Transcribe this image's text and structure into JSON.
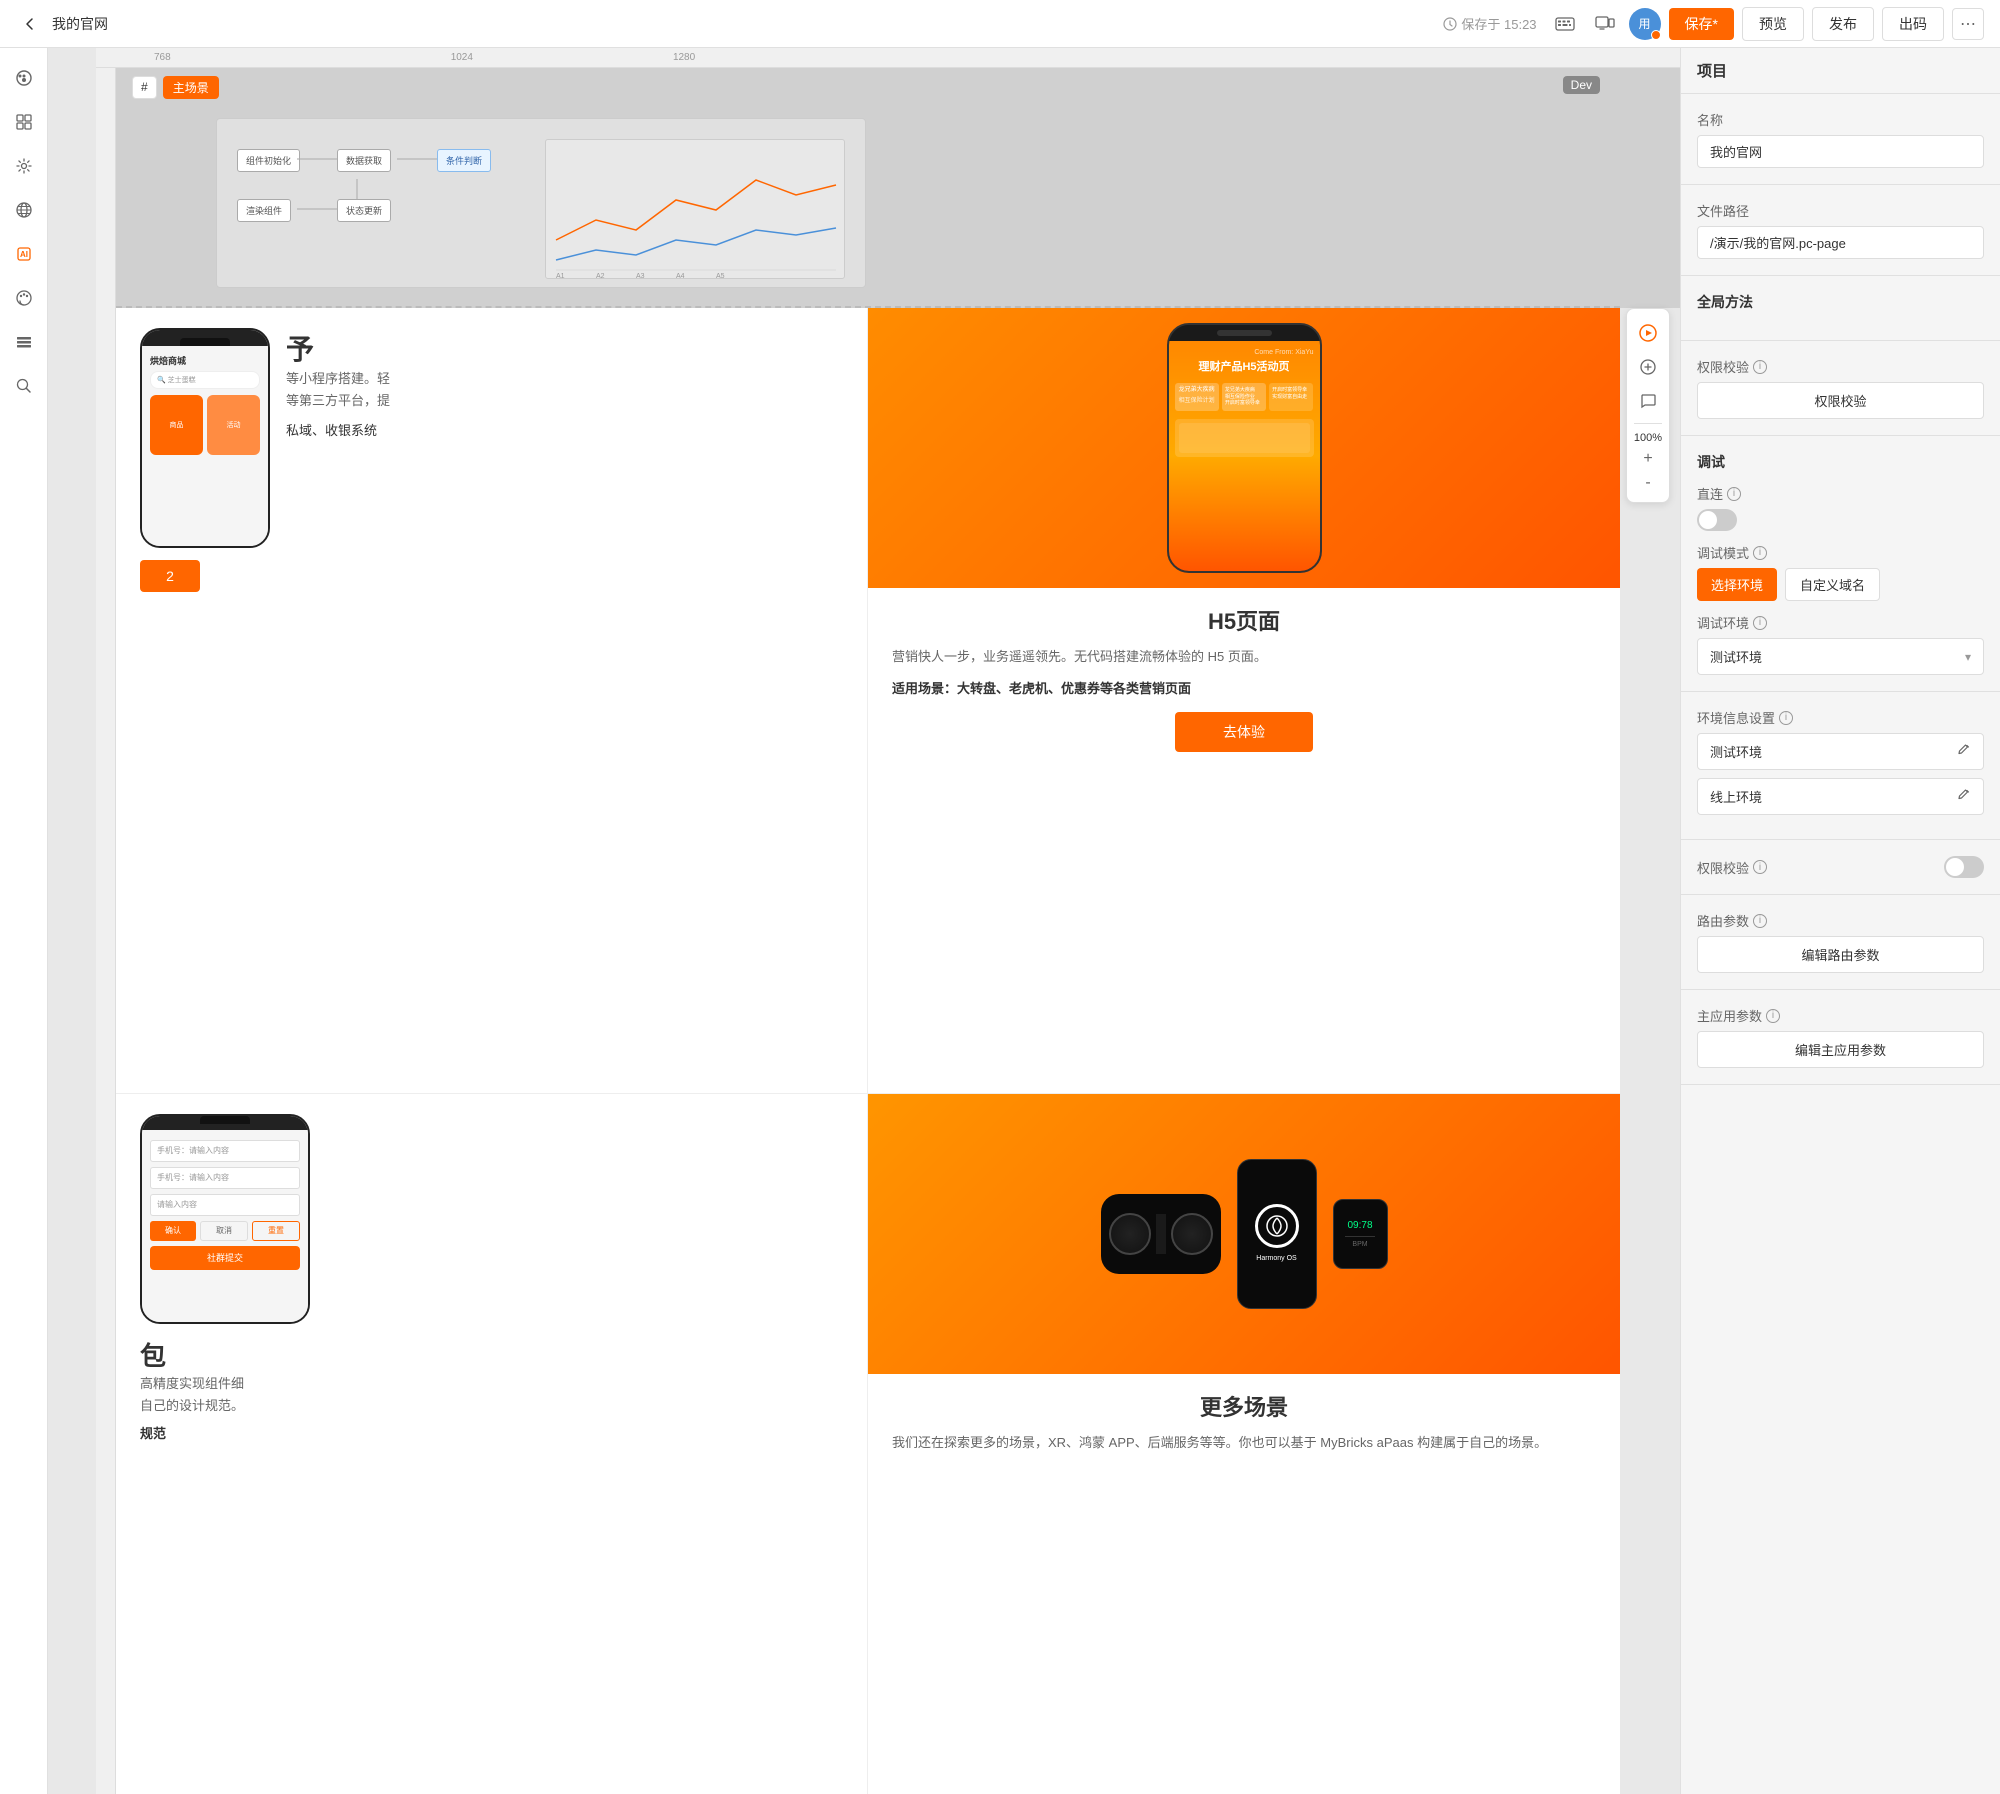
{
  "toolbar": {
    "back_label": "←",
    "page_title": "我的官网",
    "save_time": "保存于 15:23",
    "save_btn": "保存*",
    "preview_btn": "预览",
    "publish_btn": "发布",
    "code_btn": "出码",
    "more_btn": "⋯"
  },
  "canvas": {
    "tag_hash": "#",
    "tag_main": "主场景",
    "dev_badge": "Dev",
    "zoom": "100%",
    "zoom_plus": "+",
    "zoom_minus": "-",
    "ruler_left": "768",
    "ruler_right": "1280"
  },
  "cards": {
    "left_top": {
      "title_partial": "予",
      "desc_partial1": "等小程序搭建。轻",
      "desc_partial2": "等第三方平台，提",
      "scenarios_partial": "私域、收银系统",
      "btn_partial": "2"
    },
    "right_top": {
      "category": "H5页面",
      "desc": "营销快人一步，业务遥遥领先。无代码搭建流畅体验的 H5 页面。",
      "scenarios_label": "适用场景：",
      "scenarios": "大转盘、老虎机、优惠券等各类营销页面",
      "btn": "去体验",
      "phone_title": "理财产品H5活动页",
      "phone_subtitle1": "龙兄弟大疾病",
      "phone_subtitle2": "相互保险计划",
      "come_from": "Come From: XiaYu"
    },
    "left_bottom": {
      "title_partial": "包",
      "desc_partial1": "高精度实现组件细",
      "desc_partial2": "自己的设计规范。",
      "scenarios_partial": "规范"
    },
    "right_bottom": {
      "category": "更多场景",
      "desc": "我们还在探索更多的场景，XR、鸿蒙 APP、后端服务等等。你也可以基于 MyBricks aPaas 构建属于自己的场景。",
      "harmony_text": "Harmony OS"
    }
  },
  "right_panel": {
    "header": "项目",
    "name_label": "名称",
    "name_value": "我的官网",
    "path_label": "文件路径",
    "path_value": "/演示/我的官网.pc-page",
    "global_methods": "全局方法",
    "permission_label": "权限校验",
    "permission_btn": "权限校验",
    "debug_title": "调试",
    "debug_direct_label": "直连",
    "debug_mode_label": "调试模式",
    "debug_mode_btn1": "选择环境",
    "debug_mode_btn2": "自定义域名",
    "debug_env_label": "调试环境",
    "debug_env_value": "测试环境",
    "env_info_label": "环境信息设置",
    "env_test": "测试环境",
    "env_online": "线上环境",
    "permission2_label": "权限校验",
    "route_label": "路由参数",
    "route_btn": "编辑路由参数",
    "main_app_label": "主应用参数",
    "main_app_btn": "编辑主应用参数"
  }
}
